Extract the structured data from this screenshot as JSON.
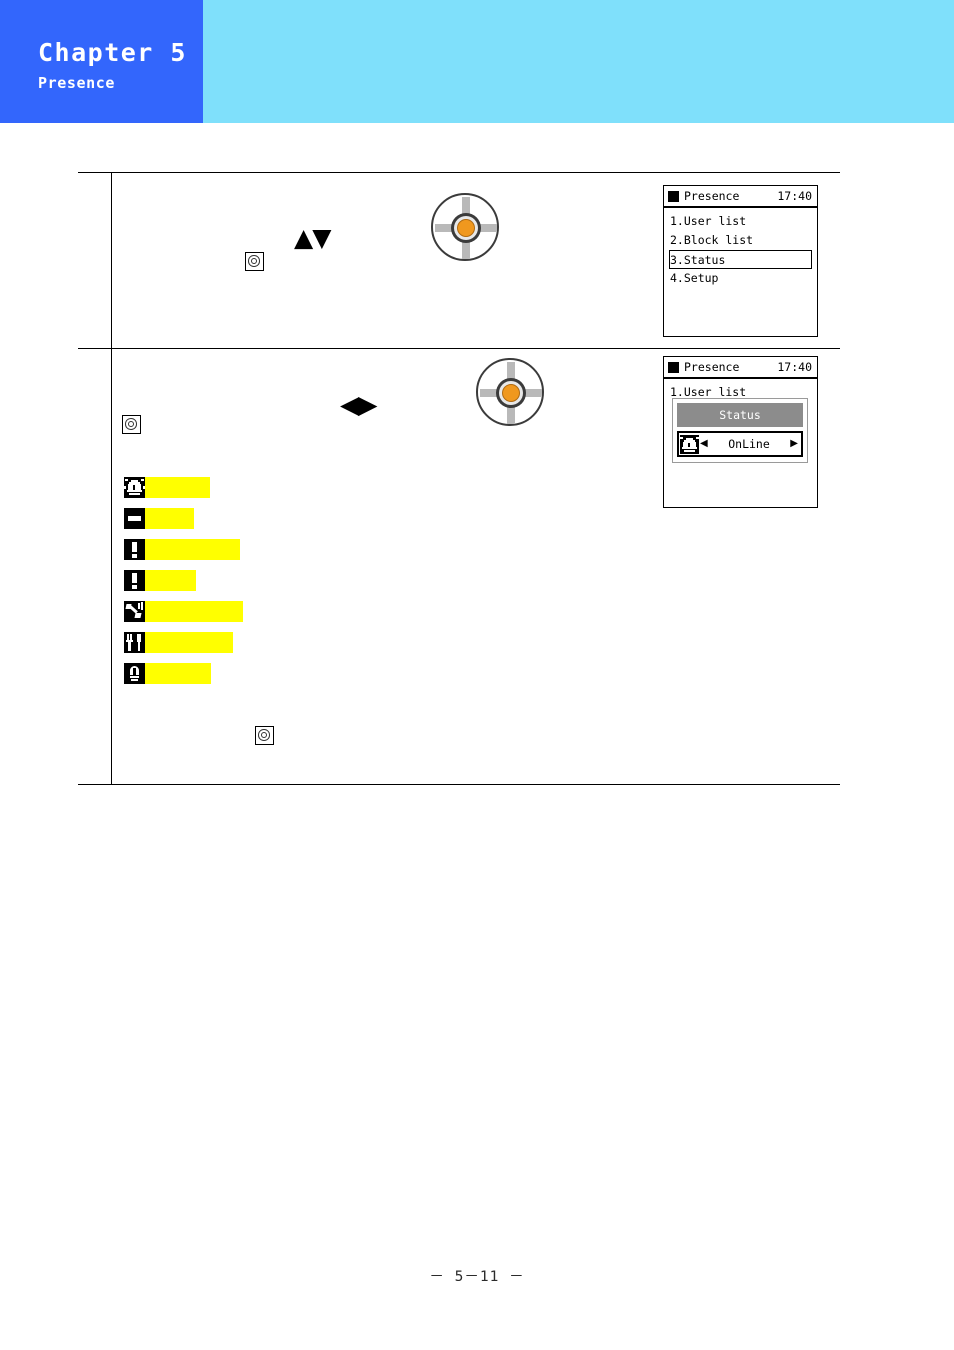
{
  "header": {
    "chapter": "Chapter 5",
    "section": "Presence",
    "block_color": "#3366fc",
    "band_color": "#7fe0fb"
  },
  "steps": [
    {
      "id": "step-1",
      "keys": {
        "direction_arrows": "▲▼",
        "enter_icon": "enter-key-icon",
        "navkey_icon": "navigation-wheel-icon"
      }
    },
    {
      "id": "step-2",
      "keys": {
        "direction_arrows": "◀▶",
        "enter_icon": "enter-key-icon",
        "navkey_icon": "navigation-wheel-icon"
      }
    }
  ],
  "status_list": [
    {
      "icon": "presence-online-icon",
      "label": "",
      "label_width": 65,
      "highlight": "#ffff00"
    },
    {
      "icon": "presence-dash-icon",
      "label": "",
      "label_width": 49,
      "highlight": "#ffff00"
    },
    {
      "icon": "presence-alert-icon",
      "label": "",
      "label_width": 95,
      "highlight": "#ffff00"
    },
    {
      "icon": "presence-alert-icon",
      "label": "",
      "label_width": 51,
      "highlight": "#ffff00"
    },
    {
      "icon": "presence-phone-icon",
      "label": "",
      "label_width": 98,
      "highlight": "#ffff00"
    },
    {
      "icon": "presence-lunch-icon",
      "label": "",
      "label_width": 88,
      "highlight": "#ffff00"
    },
    {
      "icon": "presence-lamp-icon",
      "label": "",
      "label_width": 66,
      "highlight": "#ffff00"
    }
  ],
  "lcd_menu": {
    "title": "Presence",
    "time": "17:40",
    "items": [
      {
        "label": "1.User list",
        "selected": false
      },
      {
        "label": "2.Block list",
        "selected": false
      },
      {
        "label": "3.Status",
        "selected": true
      },
      {
        "label": "4.Setup",
        "selected": false
      }
    ]
  },
  "lcd_dialog": {
    "title": "Presence",
    "time": "17:40",
    "background_item": "1.User list",
    "dialog_title": "Status",
    "value": "OnLine",
    "value_icon": "presence-online-icon",
    "left_arrow": "◀",
    "right_arrow": "▶"
  },
  "footer": {
    "page": "－ 5－11 －"
  }
}
